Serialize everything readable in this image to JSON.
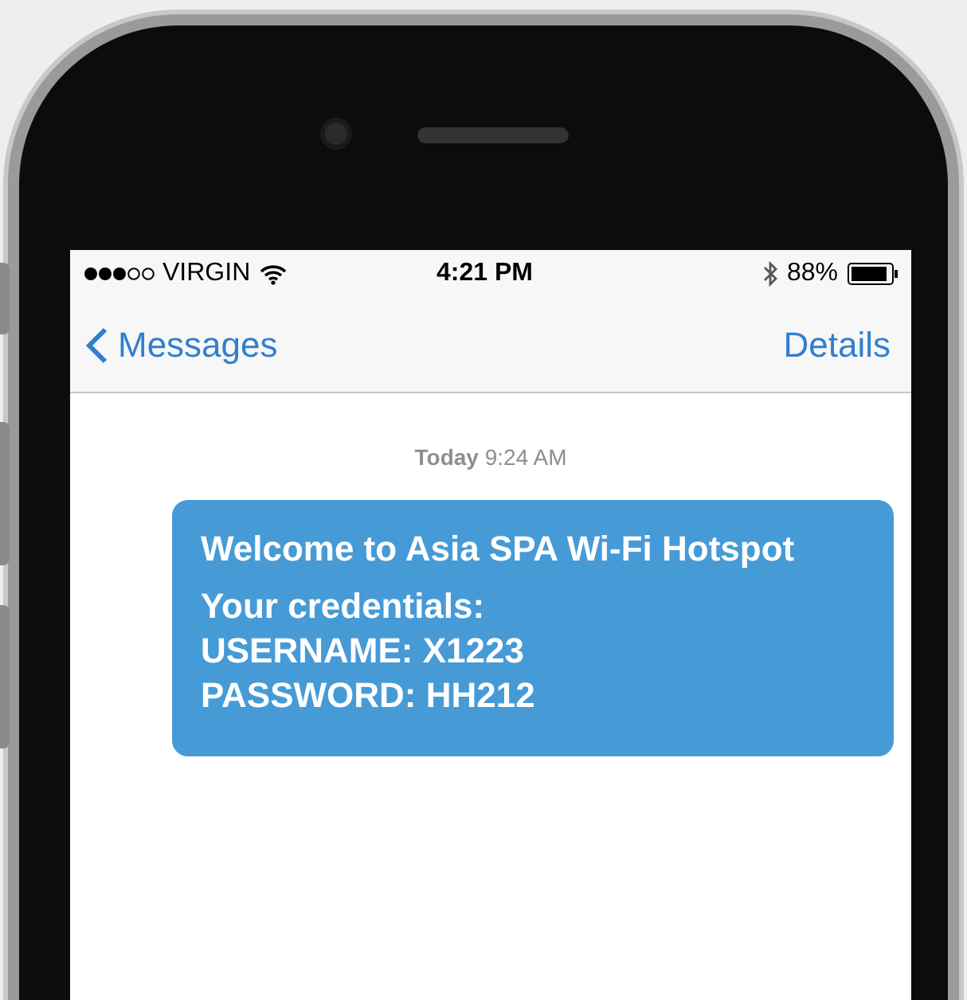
{
  "status_bar": {
    "carrier": "VIRGIN",
    "time": "4:21 PM",
    "battery": "88%"
  },
  "nav_bar": {
    "back": "Messages",
    "action": "Details"
  },
  "timestamp": {
    "day": "Today",
    "time": "9:24 AM"
  },
  "message": {
    "lines": [
      "Welcome to Asia SPA Wi-Fi Hotspot",
      "Your credentials:",
      "USERNAME: X1223",
      "PASSWORD: HH212"
    ]
  }
}
